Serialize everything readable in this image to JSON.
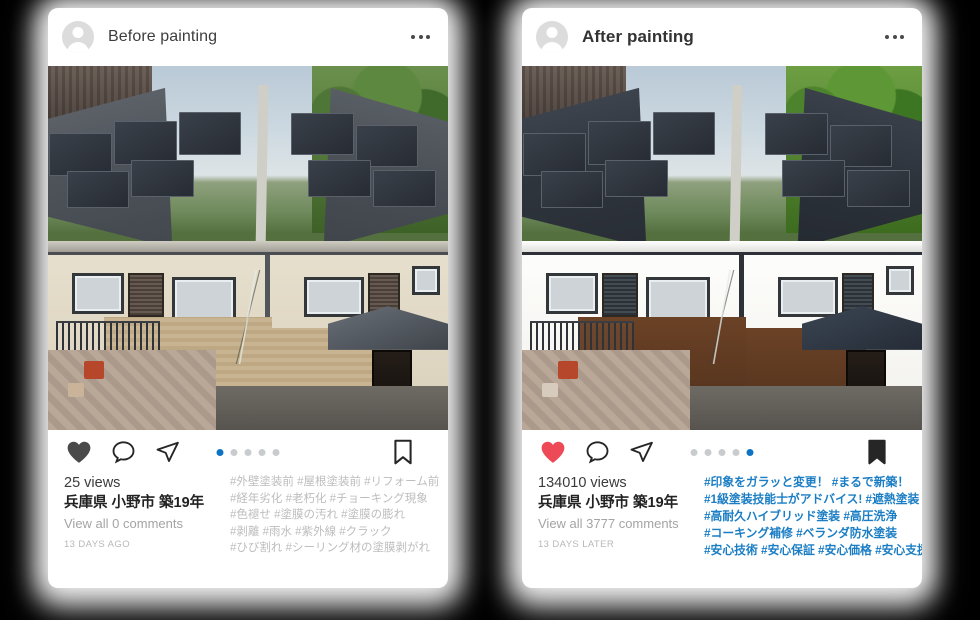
{
  "background_color": "#000000",
  "accent_colors": {
    "active_dot": "#0f73c4",
    "inactive_dot": "#c9ccce",
    "liked_heart": "#ed4956",
    "unliked_heart": "#4a4a4a",
    "blue_hashtag": "#1b7ec4",
    "grey_hashtag": "#bdbdbd"
  },
  "cards": [
    {
      "id": "before",
      "header": {
        "avatar_icon": "user-avatar-icon",
        "username": "Before painting",
        "username_bold": false,
        "menu_icon": "more-options-icon"
      },
      "photo": {
        "alt": "Two-story Japanese house before repainting, faded beige upper wall, tan brick lower wall, grey tiled roof with solar panels"
      },
      "actions": {
        "like_icon": "heart-icon",
        "like_filled": true,
        "like_color": "#4a4a4a",
        "comment_icon": "comment-bubble-icon",
        "share_icon": "share-paper-plane-icon",
        "save_icon": "bookmark-icon",
        "save_filled": false,
        "dots_total": 5,
        "dots_active_index": 0
      },
      "meta": {
        "views": "25 views",
        "place": "兵庫県 小野市 築19年",
        "comments": "View all 0 comments",
        "timestamp": "13 DAYS AGO"
      },
      "hashtag_style": "grey",
      "hashtag_lines": [
        "#外壁塗装前 #屋根塗装前 #リフォーム前",
        "#経年劣化 #老朽化 #チョーキング現象",
        "#色褪せ #塗膜の汚れ #塗膜の膨れ",
        "#剥離 #雨水 #紫外線 #クラック",
        "#ひび割れ #シーリング材の塗膜剥がれ"
      ]
    },
    {
      "id": "after",
      "header": {
        "avatar_icon": "user-avatar-icon",
        "username": "After painting",
        "username_bold": true,
        "menu_icon": "more-options-icon"
      },
      "photo": {
        "alt": "Same house after repainting, bright white upper wall, dark brown lower wall, dark navy roof with solar panels"
      },
      "actions": {
        "like_icon": "heart-icon",
        "like_filled": true,
        "like_color": "#ed4956",
        "comment_icon": "comment-bubble-icon",
        "share_icon": "share-paper-plane-icon",
        "save_icon": "bookmark-icon",
        "save_filled": true,
        "dots_total": 5,
        "dots_active_index": 4
      },
      "meta": {
        "views": "134010 views",
        "place": "兵庫県 小野市 築19年",
        "comments": "View all 3777 comments",
        "timestamp": "13 DAYS LATER"
      },
      "hashtag_style": "blue",
      "hashtag_lines": [
        "#印象をガラッと変更！ #まるで新築！",
        "#1級塗装技能士がアドバイス! #遮熱塗装",
        "#高耐久ハイブリッド塗装 #高圧洗浄",
        "#コーキング補修 #ベランダ防水塗装",
        "#安心技術 #安心保証 #安心価格 #安心支援"
      ]
    }
  ]
}
